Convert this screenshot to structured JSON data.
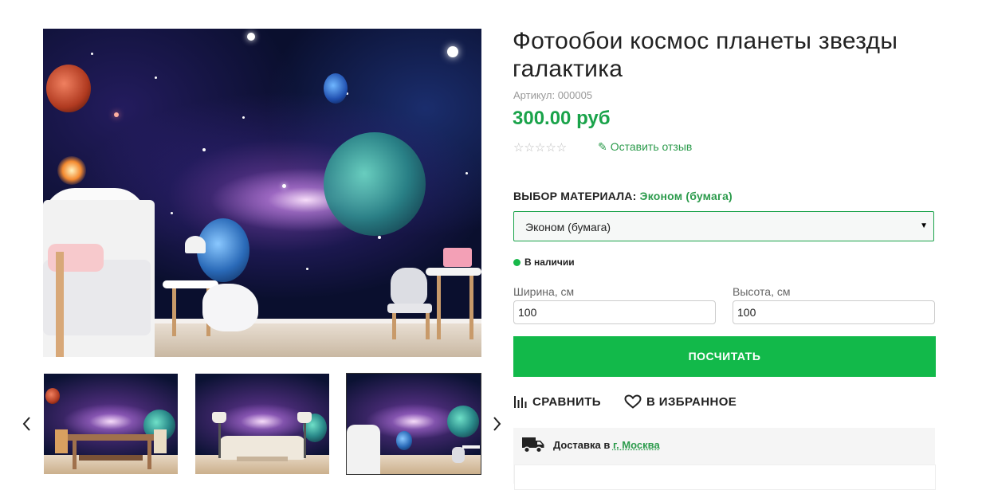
{
  "product": {
    "title": "Фотообои космос планеты звезды галактика",
    "sku": "Артикул: 000005",
    "price": "300.00 руб",
    "rating_stars": "☆☆☆☆☆",
    "review_link": "Оставить отзыв"
  },
  "material": {
    "label": "ВЫБОР МАТЕРИАЛА:",
    "selected": "Эконом (бумага)",
    "select_value": "Эконом (бумага)"
  },
  "stock": {
    "status": "В наличии"
  },
  "dimensions": {
    "width_label": "Ширина, см",
    "width_value": "100",
    "height_label": "Высота, см",
    "height_value": "100"
  },
  "calculate_button": "ПОСЧИТАТЬ",
  "actions": {
    "compare": "СРАВНИТЬ",
    "favorite": "В ИЗБРАННОЕ"
  },
  "delivery": {
    "prefix": "Доставка в ",
    "city": "г. Москва"
  },
  "gallery": {
    "thumbnails": [
      "dining-room",
      "living-room",
      "kids-room"
    ],
    "active_thumbnail": 2
  },
  "colors": {
    "accent_green": "#12b94a",
    "price_green": "#1aa34a",
    "stock_dot": "#18b94a"
  },
  "icons": {
    "prev": "chevron-left-icon",
    "next": "chevron-right-icon",
    "compare": "bar-chart-icon",
    "favorite": "heart-icon",
    "review": "pencil-icon",
    "delivery": "truck-icon"
  }
}
